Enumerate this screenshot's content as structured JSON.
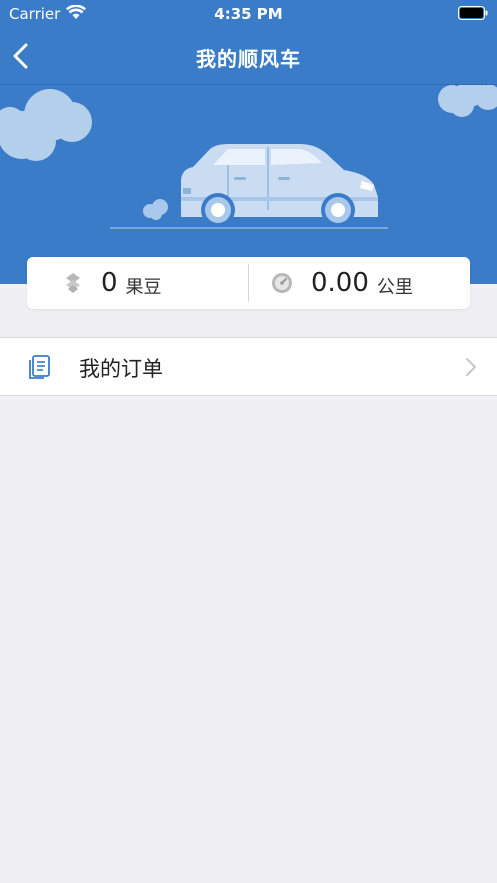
{
  "status_bar": {
    "carrier": "Carrier",
    "time": "4:35 PM"
  },
  "nav": {
    "title": "我的顺风车",
    "back_icon": "chevron-left-icon"
  },
  "stats": {
    "beans_value": "0",
    "beans_unit": "果豆",
    "distance_value": "0.00",
    "distance_unit": "公里"
  },
  "menu": [
    {
      "label": "我的订单",
      "icon": "document-icon"
    }
  ],
  "colors": {
    "primary": "#3a7cc8",
    "background": "#efeff4",
    "icon_blue": "#3a7cc8"
  }
}
